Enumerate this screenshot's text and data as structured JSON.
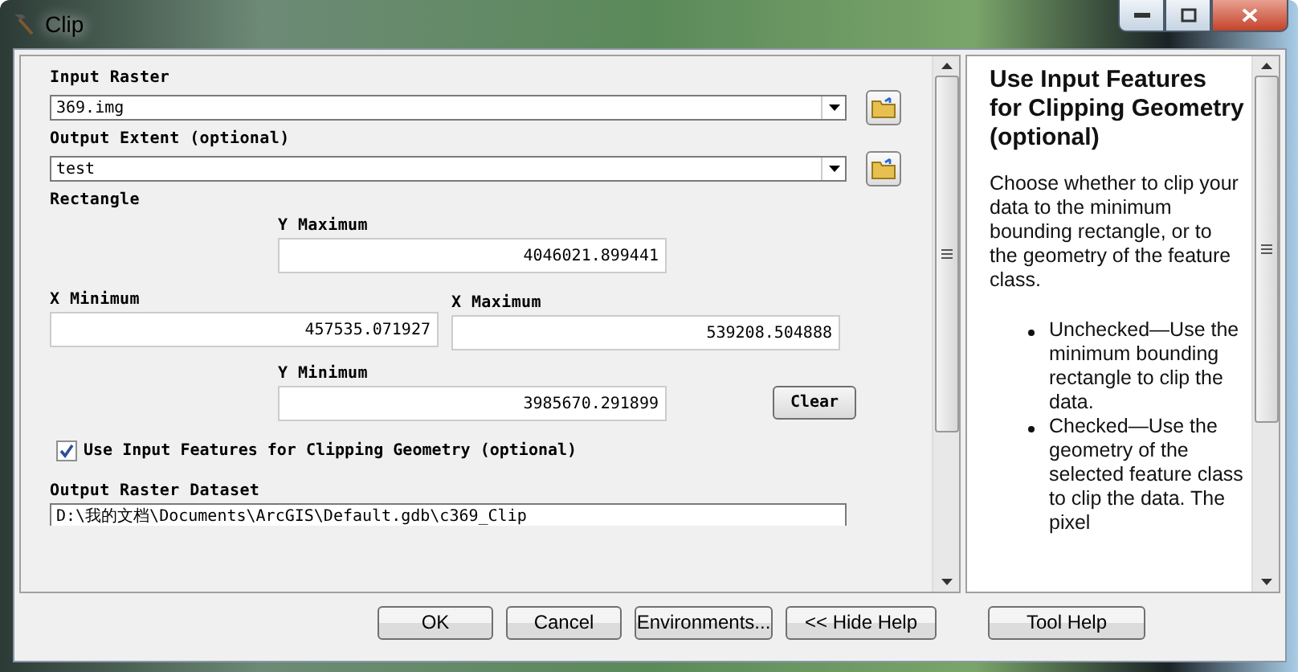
{
  "window": {
    "title": "Clip"
  },
  "form": {
    "input_raster": {
      "label": "Input Raster",
      "value": "369.img"
    },
    "output_extent": {
      "label": "Output Extent (optional)",
      "value": "test"
    },
    "rectangle": {
      "label": "Rectangle",
      "y_max": {
        "label": "Y Maximum",
        "value": "4046021.899441"
      },
      "x_min": {
        "label": "X Minimum",
        "value": "457535.071927"
      },
      "x_max": {
        "label": "X Maximum",
        "value": "539208.504888"
      },
      "y_min": {
        "label": "Y Minimum",
        "value": "3985670.291899"
      },
      "clear_button": "Clear"
    },
    "use_input_features": {
      "label": "Use Input Features for Clipping Geometry (optional)",
      "checked": true
    },
    "output_raster": {
      "label": "Output Raster Dataset",
      "value": "D:\\我的文档\\Documents\\ArcGIS\\Default.gdb\\c369_Clip"
    }
  },
  "help": {
    "title": "Use Input Features for Clipping Geometry (optional)",
    "intro": "Choose whether to clip your data to the minimum bounding rectangle, or to the geometry of the feature class.",
    "bullets": [
      "Unchecked—Use the minimum bounding rectangle to clip the data.",
      "Checked—Use the geometry of the selected feature class to clip the data. The pixel"
    ]
  },
  "buttons": [
    "OK",
    "Cancel",
    "Environments...",
    "<< Hide Help"
  ],
  "tool_help_button": "Tool Help"
}
